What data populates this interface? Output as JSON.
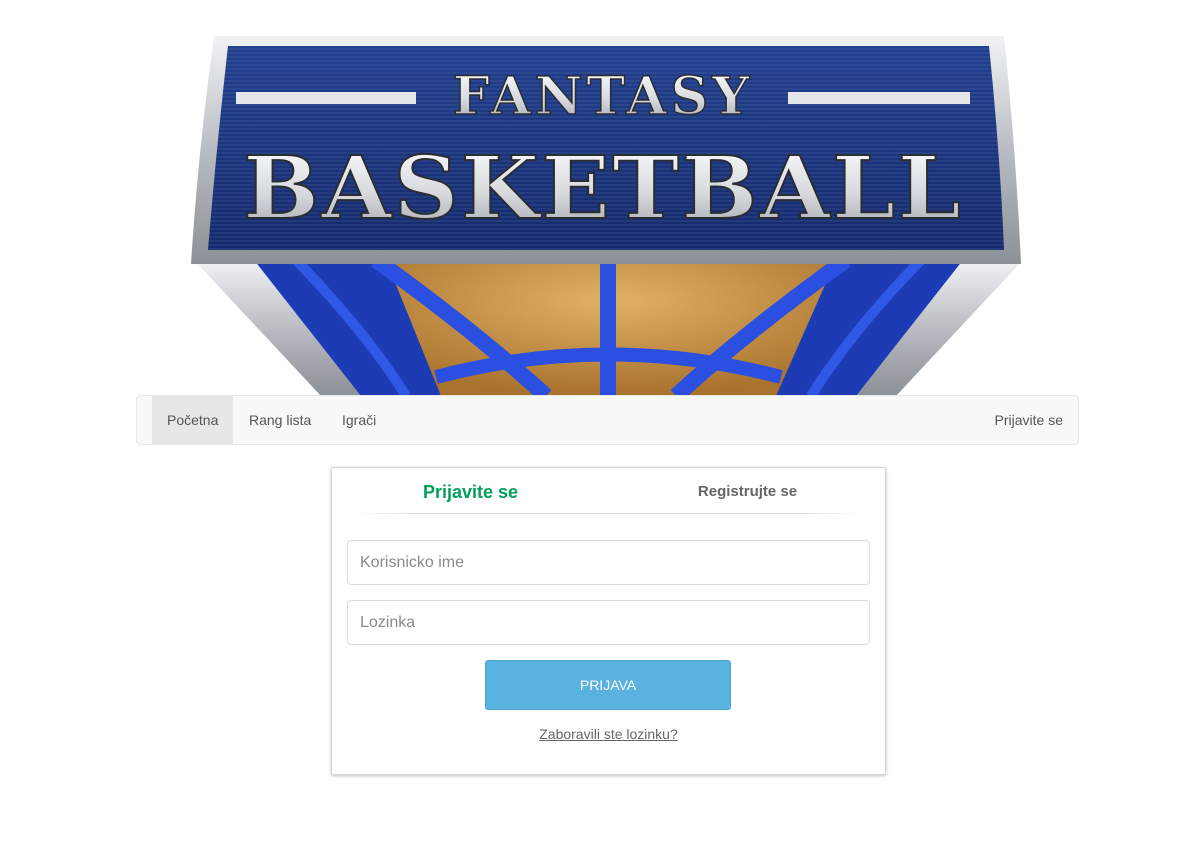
{
  "banner": {
    "line1": "FANTASY",
    "line2": "BASKETBALL",
    "colors": {
      "shield_blue": "#1e3a8a",
      "shield_dark": "#0f1f5c",
      "glow_blue": "#2a4fd6",
      "ball_orange": "#c8913e",
      "silver": "#c9ccd1"
    }
  },
  "nav": {
    "home": "Početna",
    "rank": "Rang lista",
    "players": "Igrači",
    "login": "Prijavite se"
  },
  "panel": {
    "tab_login": "Prijavite se",
    "tab_register": "Registrujte se",
    "username_placeholder": "Korisnicko ime",
    "password_placeholder": "Lozinka",
    "submit_label": "PRIJAVA",
    "forgot_label": "Zaboravili ste lozinku?",
    "colors": {
      "active_tab": "#029f5b",
      "button": "#59b2e0"
    }
  }
}
